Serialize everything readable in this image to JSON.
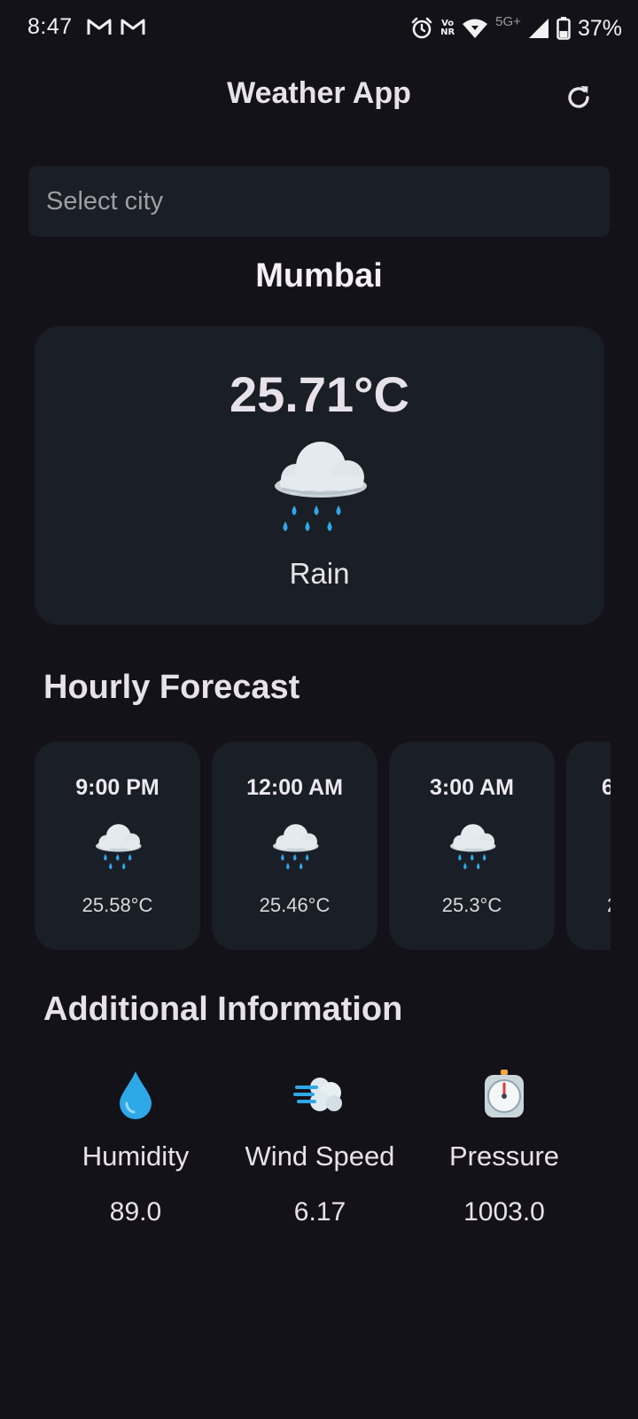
{
  "status_bar": {
    "time": "8:47",
    "volte_top": "Vo",
    "volte_bottom": "NR",
    "network": "5G+",
    "battery": "37%"
  },
  "app_bar": {
    "title": "Weather App",
    "refresh_icon": "refresh-icon"
  },
  "search": {
    "placeholder": "Select city",
    "value": ""
  },
  "current": {
    "city": "Mumbai",
    "temperature": "25.71°C",
    "condition": "Rain",
    "icon": "rain-cloud-icon"
  },
  "hourly": {
    "title": "Hourly Forecast",
    "items": [
      {
        "time": "9:00 PM",
        "icon": "rain-cloud-icon",
        "temp": "25.58°C"
      },
      {
        "time": "12:00 AM",
        "icon": "rain-cloud-icon",
        "temp": "25.46°C"
      },
      {
        "time": "3:00 AM",
        "icon": "rain-cloud-icon",
        "temp": "25.3°C"
      },
      {
        "time": "6",
        "icon": "rain-cloud-icon",
        "temp": "2"
      }
    ]
  },
  "additional": {
    "title": "Additional Information",
    "items": [
      {
        "label": "Humidity",
        "value": "89.0",
        "icon": "droplet-icon"
      },
      {
        "label": "Wind Speed",
        "value": "6.17",
        "icon": "wind-icon"
      },
      {
        "label": "Pressure",
        "value": "1003.0",
        "icon": "timer-icon"
      }
    ]
  },
  "colors": {
    "background": "#131218",
    "card": "#1a1e26",
    "text": "#e6e1ea",
    "rain_drop": "#2fa8e8",
    "cloud": "#dfe6ea"
  }
}
